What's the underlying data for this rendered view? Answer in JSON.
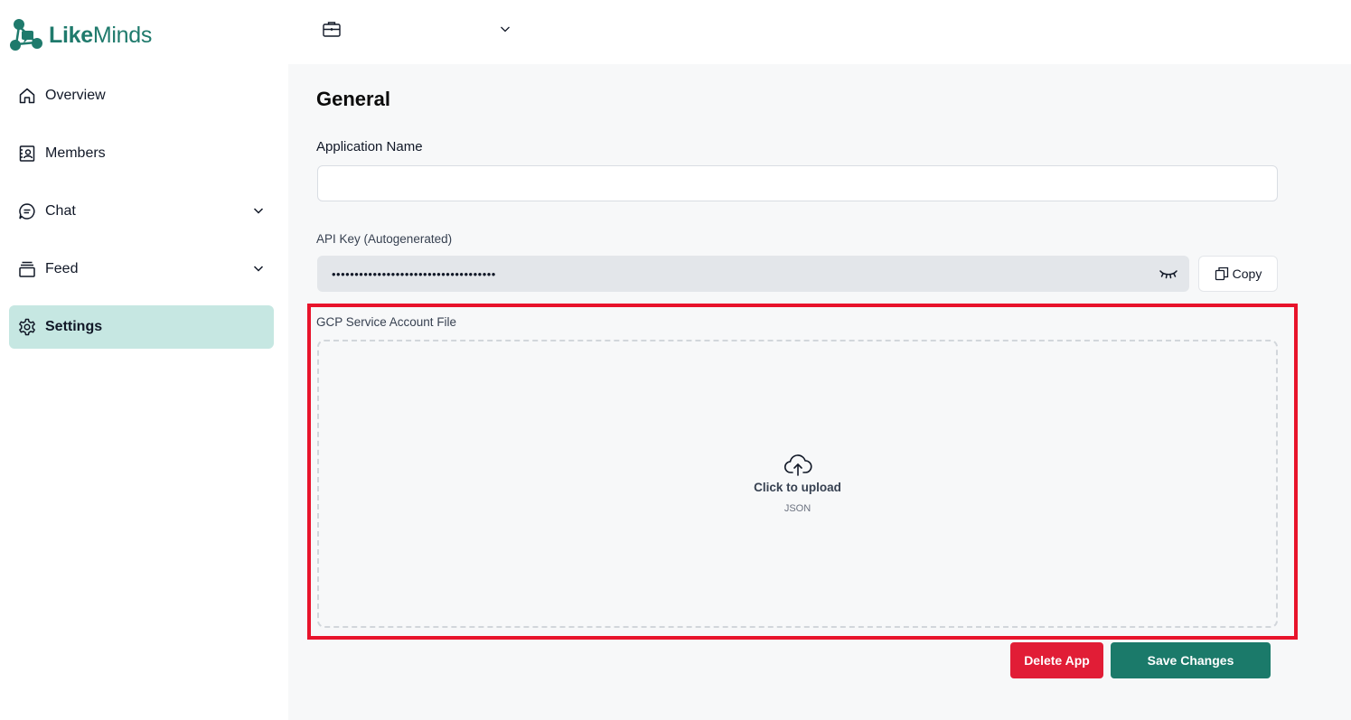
{
  "brand": {
    "name_bold": "Like",
    "name_rest": "Minds",
    "color": "#1f7a6c"
  },
  "sidebar": {
    "items": [
      {
        "label": "Overview",
        "icon": "home-icon",
        "expandable": false,
        "active": false
      },
      {
        "label": "Members",
        "icon": "contact-card-icon",
        "expandable": false,
        "active": false
      },
      {
        "label": "Chat",
        "icon": "chat-bubble-icon",
        "expandable": true,
        "active": false
      },
      {
        "label": "Feed",
        "icon": "feed-stack-icon",
        "expandable": true,
        "active": false
      },
      {
        "label": "Settings",
        "icon": "gear-icon",
        "expandable": false,
        "active": true
      }
    ],
    "active_color": "#c6e7e2"
  },
  "topbar": {
    "org_icon": "briefcase-icon",
    "org_name": ""
  },
  "main": {
    "title": "General",
    "app_name": {
      "label": "Application Name",
      "value": "",
      "placeholder": ""
    },
    "api_key": {
      "label": "API Key (Autogenerated)",
      "masked_value": "••••••••••••••••••••••••••••••••••••",
      "toggle_icon": "eye-closed-icon",
      "copy_label": "Copy",
      "copy_icon": "copy-icon"
    },
    "gcp": {
      "label": "GCP Service Account File",
      "upload_icon": "cloud-upload-icon",
      "upload_text": "Click to upload",
      "file_type": "JSON",
      "highlight_color": "#e8132b"
    },
    "actions": {
      "delete_label": "Delete App",
      "save_label": "Save Changes",
      "delete_color": "#e11d36",
      "save_color": "#1b7a6a"
    }
  }
}
